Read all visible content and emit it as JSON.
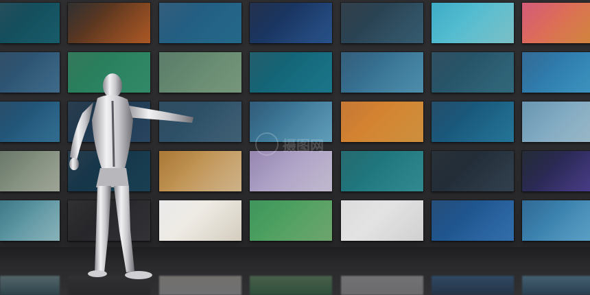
{
  "scene": {
    "description_free": true,
    "wall_rows": 5,
    "wall_cols": 7,
    "tiles": [
      {
        "name": "tile-r1-c1",
        "colors": [
          "#0f3b4a",
          "#1c6b7a"
        ]
      },
      {
        "name": "tile-r1-c2",
        "colors": [
          "#1a1a1a",
          "#c8662a"
        ]
      },
      {
        "name": "tile-r1-c3",
        "colors": [
          "#1e4c6e",
          "#2a7aa0"
        ]
      },
      {
        "name": "tile-r1-c4",
        "colors": [
          "#0b1b3a",
          "#2f5fa0"
        ]
      },
      {
        "name": "tile-r1-c5",
        "colors": [
          "#1c2a36",
          "#3f6a82"
        ]
      },
      {
        "name": "tile-r1-c6",
        "colors": [
          "#2aa3c0",
          "#8fe0e8"
        ]
      },
      {
        "name": "tile-r1-c7",
        "colors": [
          "#d04a6a",
          "#f0a040"
        ]
      },
      {
        "name": "tile-r2-c1",
        "colors": [
          "#1b3b57",
          "#4a7ca0"
        ]
      },
      {
        "name": "tile-r2-c2",
        "colors": [
          "#1e6a4a",
          "#3aa07a"
        ]
      },
      {
        "name": "tile-r2-c3",
        "colors": [
          "#4a6e5a",
          "#8ab08f"
        ]
      },
      {
        "name": "tile-r2-c4",
        "colors": [
          "#0c4c5c",
          "#1f8aa0"
        ]
      },
      {
        "name": "tile-r2-c5",
        "colors": [
          "#1f4c6c",
          "#5aa6c8"
        ]
      },
      {
        "name": "tile-r2-c6",
        "colors": [
          "#1a3c50",
          "#3a7a90"
        ]
      },
      {
        "name": "tile-r2-c7",
        "colors": [
          "#1e5a8a",
          "#48b0e0"
        ]
      },
      {
        "name": "tile-r3-c1",
        "colors": [
          "#123a5a",
          "#3a80a8"
        ]
      },
      {
        "name": "tile-r3-c2",
        "colors": [
          "#12283a",
          "#305070"
        ]
      },
      {
        "name": "tile-r3-c3",
        "colors": [
          "#1a3a50",
          "#4a7088"
        ]
      },
      {
        "name": "tile-r3-c4",
        "colors": [
          "#1a4a6a",
          "#70b8d8"
        ]
      },
      {
        "name": "tile-r3-c5",
        "colors": [
          "#c06a20",
          "#f0a848"
        ]
      },
      {
        "name": "tile-r3-c6",
        "colors": [
          "#0e3a5a",
          "#2a88b0"
        ]
      },
      {
        "name": "tile-r3-c7",
        "colors": [
          "#5a8aa8",
          "#b8d8e8"
        ]
      },
      {
        "name": "tile-r4-c1",
        "colors": [
          "#5a6a5a",
          "#b8c0b0"
        ]
      },
      {
        "name": "tile-r4-c2",
        "colors": [
          "#10283a",
          "#1e4a60"
        ]
      },
      {
        "name": "tile-r4-c3",
        "colors": [
          "#a06a20",
          "#f0d0a0"
        ]
      },
      {
        "name": "tile-r4-c4",
        "colors": [
          "#8a7aa8",
          "#e0d8f0"
        ]
      },
      {
        "name": "tile-r4-c5",
        "colors": [
          "#0e5a60",
          "#3aa0a8"
        ]
      },
      {
        "name": "tile-r4-c6",
        "colors": [
          "#121a22",
          "#3a4a5a"
        ]
      },
      {
        "name": "tile-r4-c7",
        "colors": [
          "#0c1420",
          "#5a4aa8"
        ]
      },
      {
        "name": "tile-r5-c1",
        "colors": [
          "#2a6a7a",
          "#a0d0d8"
        ]
      },
      {
        "name": "tile-r5-c2",
        "colors": [
          "#1a1a1c",
          "#3a3a40"
        ]
      },
      {
        "name": "tile-r5-c3",
        "colors": [
          "#e8e8e8",
          "#f8f0e0"
        ]
      },
      {
        "name": "tile-r5-c4",
        "colors": [
          "#2a8a4a",
          "#80c080"
        ]
      },
      {
        "name": "tile-r5-c5",
        "colors": [
          "#d8d8d8",
          "#f4f4f4"
        ]
      },
      {
        "name": "tile-r5-c6",
        "colors": [
          "#0e3a6a",
          "#3a80c8"
        ]
      },
      {
        "name": "tile-r5-c7",
        "colors": [
          "#1a5a8a",
          "#70c0e8"
        ]
      }
    ],
    "figure_color": "#d8d8dc",
    "watermark_text": "摄图网"
  }
}
